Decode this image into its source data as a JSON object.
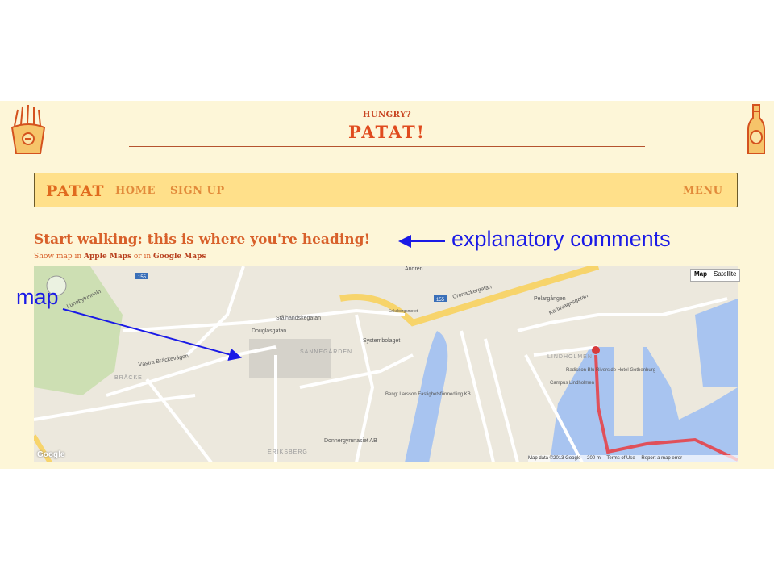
{
  "header": {
    "tagline": "HUNGRY?",
    "title": "PATAT!"
  },
  "navbar": {
    "brand": "PATAT",
    "links": [
      "HOME",
      "SIGN UP"
    ],
    "menu": "MENU"
  },
  "content": {
    "heading": "Start walking: this is where you're heading!",
    "show_prefix": "Show map in ",
    "apple_maps": "Apple Maps",
    "or_in": " or in ",
    "google_maps": "Google Maps"
  },
  "map": {
    "type_buttons": [
      "Map",
      "Satellite"
    ],
    "labels": [
      "Lundbytunneln",
      "Stålhandskegatan",
      "Systembolaget",
      "Douglasgatan",
      "SANNEGÅRDEN",
      "BRÄCKE",
      "Västra Bräckevägen",
      "LINDHOLMEN",
      "Radisson Blu Riverside Hotel Gothenburg",
      "Bengt Larsson Fastighetsförmedling KB",
      "Donnergymnasiet AB",
      "ERIKSBERG",
      "Eriksbergsmotet",
      "Andren",
      "Cronackergatan",
      "Karlavagnsgatan",
      "Pelargången",
      "Campus Lindholmen"
    ],
    "road_badges": [
      "155",
      "155"
    ],
    "google": "Google",
    "footer": {
      "data": "Map data ©2013 Google",
      "scale": "200 m",
      "terms": "Terms of Use",
      "report": "Report a map error"
    },
    "colors": {
      "water": "#a8c4f0",
      "park": "#cddfb3",
      "route": "#e0505a",
      "major_road": "#f7d46b"
    }
  },
  "annotations": {
    "explanatory": "explanatory comments",
    "map": "map",
    "color": "#1a1ae6"
  }
}
